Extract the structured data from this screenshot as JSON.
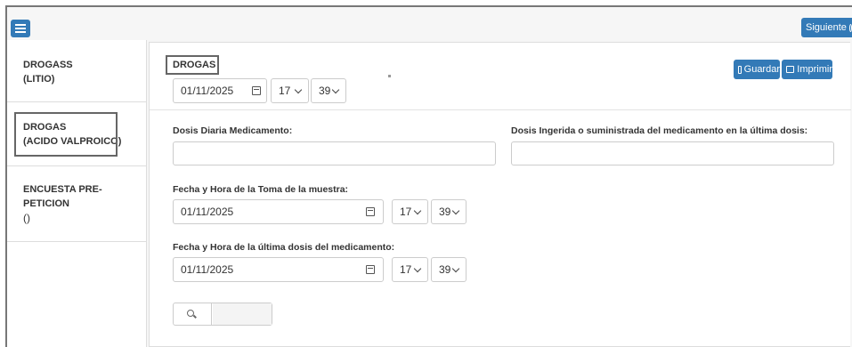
{
  "top": {
    "next_label": "Siguiente"
  },
  "sidebar": {
    "items": [
      {
        "line1": "DROGASS",
        "line2": "(LITIO)"
      },
      {
        "line1": "DROGAS",
        "line2": "(ACIDO VALPROICO)"
      },
      {
        "line1": "ENCUESTA PRE-",
        "line2": "PETICION",
        "line3": "()"
      }
    ]
  },
  "panel": {
    "title": "DROGAS",
    "save_label": "Guardar",
    "print_label": "Imprimir",
    "header_date": "01/11/2025",
    "header_hour": "17",
    "header_minute": "39",
    "daily_dose_label": "Dosis Diaria Medicamento:",
    "daily_dose_value": "",
    "last_dose_label": "Dosis Ingerida o suministrada del medicamento en la última dosis:",
    "last_dose_value": "",
    "sample_label": "Fecha y Hora de la Toma de la muestra:",
    "sample_date": "01/11/2025",
    "sample_hour": "17",
    "sample_minute": "39",
    "last_dose_time_label": "Fecha y Hora de la última dosis del medicamento:",
    "last_dose_date": "01/11/2025",
    "last_dose_hour": "17",
    "last_dose_minute": "39",
    "search_value": ""
  },
  "colors": {
    "primary": "#337ab7",
    "border": "#cccccc"
  }
}
